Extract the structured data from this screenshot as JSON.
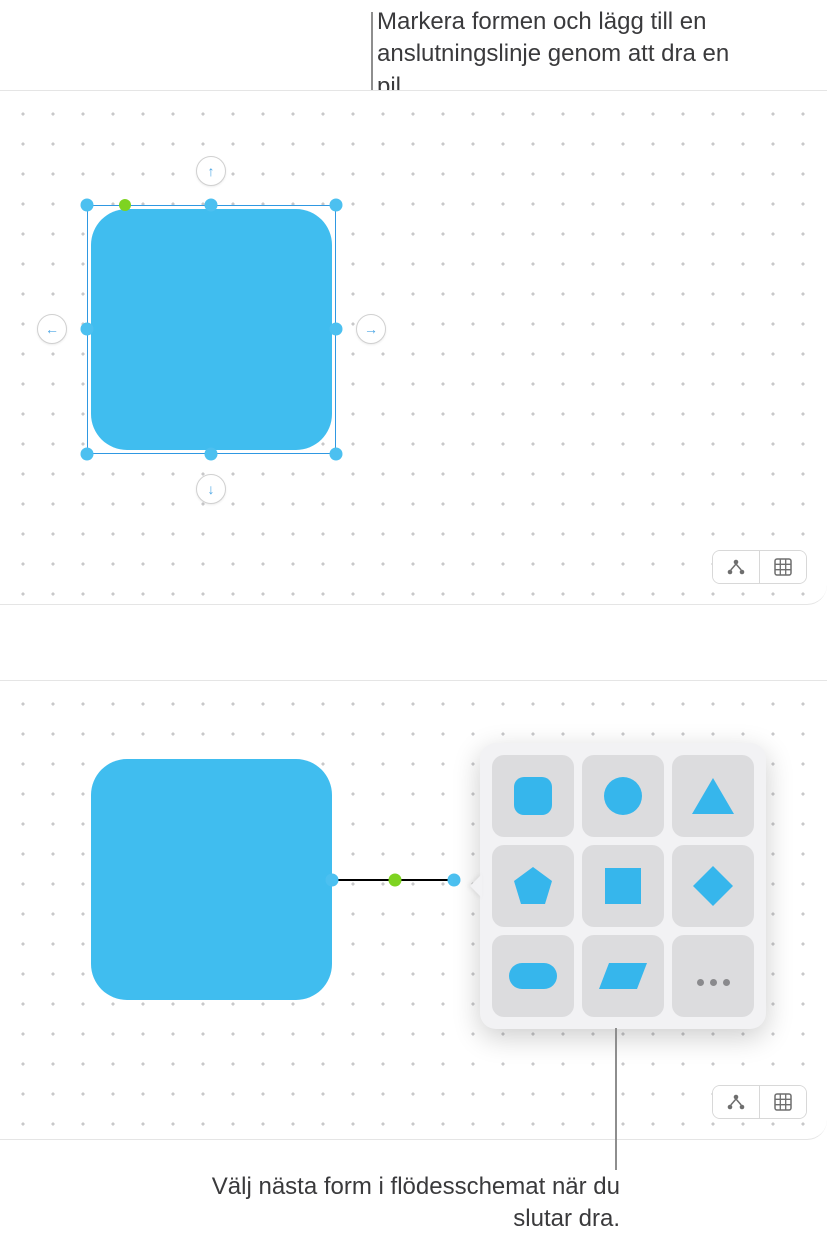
{
  "callouts": {
    "top": "Markera formen och lägg till en anslutningslinje genom att dra en pil.",
    "bottom": "Välj nästa form i flödesschemat när du slutar dra."
  },
  "shapes": {
    "main_color": "#40bdef",
    "selection_color": "#2f98e2",
    "handle_color": "#4cc0f0",
    "rotation_color": "#7ed321"
  },
  "arrows": {
    "up": "↑",
    "down": "↓",
    "left": "←",
    "right": "→"
  },
  "toolbar": {
    "diagram_icon": "diagram",
    "grid_icon": "grid"
  },
  "shape_picker": {
    "items": [
      "rounded-square",
      "circle",
      "triangle",
      "pentagon",
      "square",
      "diamond",
      "rounded-pill",
      "parallelogram",
      "more"
    ]
  }
}
